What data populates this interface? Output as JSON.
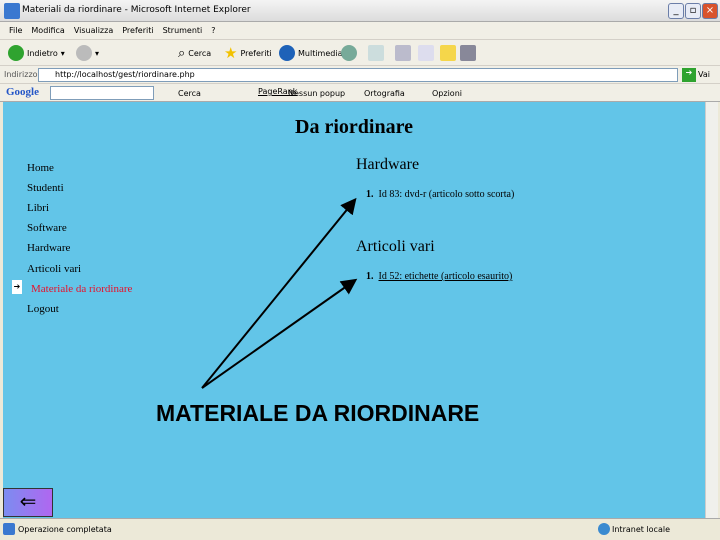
{
  "window": {
    "title": "Materiali da riordinare - Microsoft Internet Explorer"
  },
  "menu": [
    "File",
    "Modifica",
    "Visualizza",
    "Preferiti",
    "Strumenti",
    "?"
  ],
  "toolbar": {
    "back": "Indietro",
    "search": "Cerca",
    "favorites": "Preferiti",
    "media": "Multimedia"
  },
  "address": {
    "label": "Indirizzo",
    "url": "http://localhost/gest/riordinare.php",
    "go": "Vai"
  },
  "google": {
    "logo": "Google",
    "search": "Cerca",
    "pagerank": "PageRank",
    "popup": "Nessun popup",
    "spell": "Ortografia",
    "options": "Opzioni"
  },
  "page": {
    "title": "Da riordinare",
    "nav": [
      "Home",
      "Studenti",
      "Libri",
      "Software",
      "Hardware",
      "Articoli vari",
      "Materiale da riordinare",
      "Logout"
    ],
    "sections": [
      {
        "heading": "Hardware",
        "items": [
          {
            "num": "1.",
            "text": "Id 83: dvd-r (articolo sotto scorta)"
          }
        ]
      },
      {
        "heading": "Articoli vari",
        "items": [
          {
            "num": "1.",
            "text": "Id 52: etichette (articolo esaurito)"
          }
        ]
      }
    ],
    "caption": "MATERIALE DA RIORDINARE"
  },
  "status": {
    "text": "Operazione completata",
    "zone": "Intranet locale"
  },
  "colors": {
    "content_bg": "#62c5e8",
    "active_nav": "#e8102a"
  }
}
